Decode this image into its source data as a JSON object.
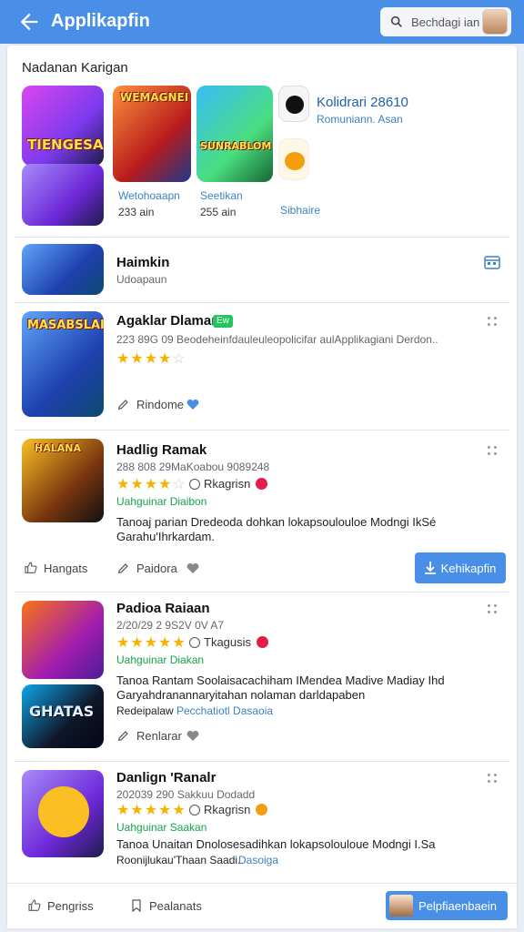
{
  "appbar": {
    "title": "Applikapfin",
    "search_placeholder": "Bechdagi ian"
  },
  "featured": {
    "section_title": "Nadanan Karigan",
    "tile_1_caption": "TIENGESAI",
    "tile_2_caption": "WEMAGNEI",
    "tile_3_caption": "SUNRABLOM",
    "tile_2_label": "Wetohoaapn",
    "tile_2_meta": "233 ain",
    "tile_3_label": "Seetikan",
    "tile_3_meta": "255 ain",
    "side_title": "Kolidrari 28610",
    "side_sub": "Romuniann. Asan",
    "side_more": "Sibhaire"
  },
  "banner_row": {
    "title": "Haimkin",
    "sub": "Udoapaun"
  },
  "items": [
    {
      "title": "Agaklar Dlamar",
      "tag": "Ew",
      "desc": "223 89G 09 Beodeheinfdauleuleopolicifar aulApplikagiani Derdon..",
      "rating": 4,
      "action_share": "Rindome",
      "thumb_caption": "MASABSLAI"
    },
    {
      "title": "Hadlig Ramak",
      "meta": "288 808 29MaKoabou 9089248",
      "rating": 4,
      "stat": "Rkagrisn",
      "green": "Uahguinar Diaibon",
      "desc": "Tanoaj parian Dredeoda dohkan lokapsoulouloe Modngi IkSé Garahu'Ihrkardam.",
      "action_like": "Hangats",
      "action_share": "Paidora",
      "primary_button": "Kehikapfin",
      "thumb_caption": "HALANA"
    },
    {
      "title": "Padioa Raiaan",
      "meta": "2/20/29 2 9S2V 0V A7",
      "rating": 5,
      "stat": "Tkagusis",
      "green": "Uahguinar Diakan",
      "desc": "Tanoa Rantam Soolaisacachiham IMendea Madive Madiay Ihd Garyahdranannaryitahan nolaman darldapaben",
      "desc_tail": "Redeipalaw",
      "link": "Pecchatiotl Dasaoia",
      "action_share": "Renlarar",
      "thumb_caption": "GHATAS"
    },
    {
      "title": "Danlign 'Ranalr",
      "meta": "202039 290 Sakkuu Dodadd",
      "rating": 5,
      "stat": "Rkagrisn",
      "green": "Uahguinar Saakan",
      "desc": "Tanoa Unaitan Dnolosesadihkan lokapsolouloue Modngi I.Sa",
      "desc_tail": "Roonijlukau'Thaan Saadi.",
      "link": "Dasoiga"
    }
  ],
  "bottom": {
    "left_label": "Pengriss",
    "mid_label": "Pealanats",
    "button_label": "Pelpfiaenbaein"
  }
}
